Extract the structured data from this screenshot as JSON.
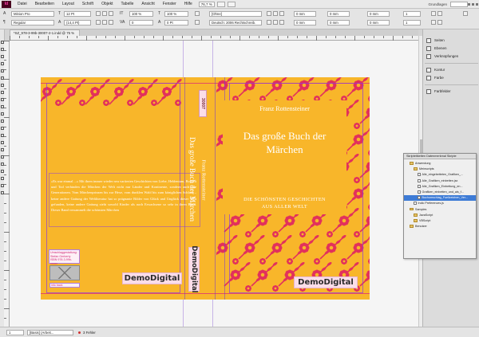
{
  "menubar": {
    "logo": "Id",
    "items": [
      "Datei",
      "Bearbeiten",
      "Layout",
      "Schrift",
      "Objekt",
      "Tabelle",
      "Ansicht",
      "Fenster",
      "Hilfe"
    ],
    "zoom": "76,7 %",
    "workspace": "Grundlagen"
  },
  "controlbar": {
    "font_family": "Minion Pro",
    "font_style": "Regular",
    "font_size": "12 Pt",
    "leading": "(14,4 Pt)",
    "scale_h": "100 %",
    "scale_v": "100 %",
    "tracking": "0",
    "baseline": "0 Pt",
    "char_style": "[Ohne]",
    "language": "Deutsch: 2006 Rechtschreib.",
    "indent_left": "0 mm",
    "indent_right": "0 mm",
    "space_before": "0 mm",
    "space_after": "0 mm",
    "columns": "1"
  },
  "document_tab": "*SZ_978-3-99b-30007-2-1.indd @ 75 %",
  "cover": {
    "author": "Franz Rottensteiner",
    "title_line1": "Das große Buch der",
    "title_line2": "Märchen",
    "subtitle_line1": "DIE SCHÖNSTEN GESCHICHTEN",
    "subtitle_line2": "AUS ALLER WELT",
    "spine_title": "Das große Buch der Märchen",
    "spine_author": "Franz Rottensteiner",
    "spine_number": "30007",
    "spine_logo": "DemoDigital",
    "front_logo": "DemoDigital",
    "back_logo": "DemoDigital",
    "blurb": "»Es war einmal ...« Mit ihren immer wieder neu variierten Geschichten von Liebe, Heldentum, Bosheit und Tod verbinden die Märchen der Welt nicht nur Länder und Kontinente, sondern auch alle Generationen. Vom Märchenprinzen bis zur Hexe, vom dunklen Wald bis zum königlichen Schloss – keine andere Gattung der Weltliteratur hat so prägnante Bilder von Glück und Unglück dieser Welt gefunden, keine andere Gattung zieht sowohl Kinder als auch Erwachsene so sehr in ihren Bann. Dieser Band versammelt die schönsten Märchen",
    "imprint_line1": "Umschlaggestaltung:",
    "imprint_line2": "Stefan Gerberty",
    "imprint_line3": "ISBN 978-3-99b-xxxxx",
    "barcode_label": "info back"
  },
  "statusbar": {
    "page": "1",
    "preflight_profile": "[Basis] (Arbeit...",
    "errors": "3 Fehler"
  },
  "dock": {
    "items": [
      "Seiten",
      "Ebenen",
      "Verknüpfungen",
      "Kontur",
      "Farbe",
      "Farbfelder"
    ]
  },
  "scripts_panel": {
    "tabs": "Skriptetiketten  Datenmerkmal  Skripte",
    "rows": [
      {
        "label": "Anwendung",
        "indent": 1,
        "kind": "folder"
      },
      {
        "label": "Meinscripts",
        "indent": 2,
        "kind": "folder"
      },
      {
        "label": "Alle_eingebetteten_Grafiken_...",
        "indent": 3,
        "kind": "file"
      },
      {
        "label": "Alle_Grafiken_einbetten.jsx",
        "indent": 3,
        "kind": "file"
      },
      {
        "label": "Alle_Grafiken_Einbettung_en...",
        "indent": 3,
        "kind": "file"
      },
      {
        "label": "Grafiken_einbetten_und_als_f...",
        "indent": 3,
        "kind": "file"
      },
      {
        "label": "Buchumschlag_Fuellzeichen_Ver...",
        "indent": 3,
        "kind": "file",
        "selected": true
      },
      {
        "label": "Indic Preferences.js",
        "indent": 2,
        "kind": "file"
      },
      {
        "label": "Samples",
        "indent": 1,
        "kind": "folder"
      },
      {
        "label": "JavaScript",
        "indent": 2,
        "kind": "folder"
      },
      {
        "label": "VBScript",
        "indent": 2,
        "kind": "folder"
      },
      {
        "label": "Benutzer",
        "indent": 1,
        "kind": "folder"
      }
    ]
  },
  "colors": {
    "cover_bg": "#f8b62a",
    "ornament": "#e2315c",
    "selection": "#3d7bd6"
  }
}
